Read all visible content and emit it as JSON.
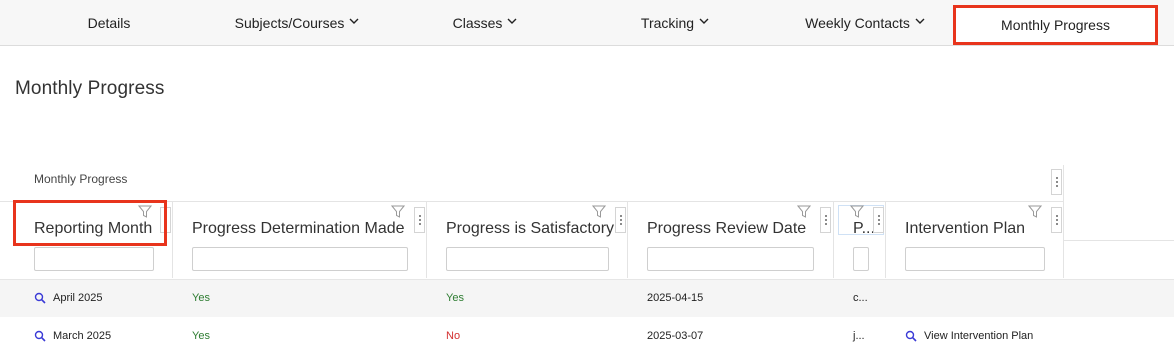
{
  "nav": {
    "items": [
      {
        "label": "Details"
      },
      {
        "label": "Subjects/Courses"
      },
      {
        "label": "Classes"
      },
      {
        "label": "Tracking"
      },
      {
        "label": "Weekly Contacts"
      },
      {
        "label": "Monthly Progress"
      }
    ]
  },
  "page": {
    "title": "Monthly Progress"
  },
  "grid": {
    "caption": "Monthly Progress",
    "columns": [
      {
        "title": "Reporting Month"
      },
      {
        "title": "Progress Determination Made"
      },
      {
        "title": "Progress is Satisfactory"
      },
      {
        "title": "Progress Review Date"
      },
      {
        "title": "P..."
      },
      {
        "title": "Intervention Plan"
      }
    ],
    "rows": [
      {
        "month": "April 2025",
        "determination": "Yes",
        "satisfactory": "Yes",
        "review_date": "2025-04-15",
        "p": "c...",
        "intervention": ""
      },
      {
        "month": "March 2025",
        "determination": "Yes",
        "satisfactory": "No",
        "review_date": "2025-03-07",
        "p": "j...",
        "intervention": "View Intervention Plan"
      }
    ]
  },
  "colors": {
    "highlight": "#e8341c",
    "yes": "#2e7d32",
    "no": "#d32f2f",
    "link_icon": "#3a3ad6"
  }
}
